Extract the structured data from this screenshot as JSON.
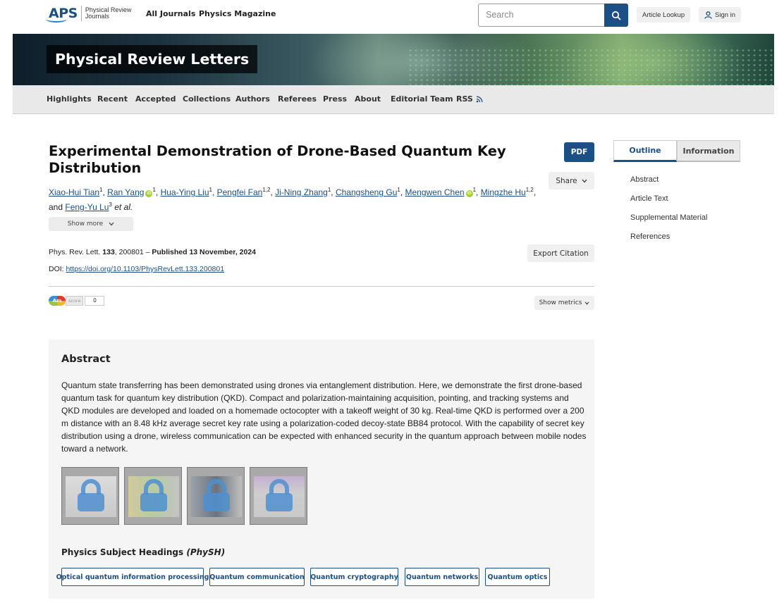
{
  "brand": {
    "logo": "APS",
    "logo_sub1": "Physical Review",
    "logo_sub2": "Journals"
  },
  "topnav": {
    "all_journals": "All Journals",
    "physics_magazine": "Physics Magazine"
  },
  "search": {
    "placeholder": "Search"
  },
  "header_actions": {
    "article_lookup": "Article Lookup",
    "sign_in": "Sign in"
  },
  "journal": {
    "title": "Physical Review Letters"
  },
  "nav": [
    "Highlights",
    "Recent",
    "Accepted",
    "Collections",
    "Authors",
    "Referees",
    "Press",
    "About",
    "Editorial Team",
    "RSS"
  ],
  "article": {
    "title": "Experimental Demonstration of Drone-Based Quantum Key Distribution",
    "pdf": "PDF",
    "share": "Share",
    "authors": [
      {
        "name": "Xiao-Hui Tian",
        "sup": "1",
        "orcid": false
      },
      {
        "name": "Ran Yang",
        "sup": "1",
        "orcid": true
      },
      {
        "name": "Hua-Ying Liu",
        "sup": "1",
        "orcid": false
      },
      {
        "name": "Pengfei Fan",
        "sup": "1,2",
        "orcid": false
      },
      {
        "name": "Ji-Ning Zhang",
        "sup": "1",
        "orcid": false
      },
      {
        "name": "Changsheng Gu",
        "sup": "1",
        "orcid": false
      },
      {
        "name": "Mengwen Chen",
        "sup": "1",
        "orcid": true
      },
      {
        "name": "Mingzhe Hu",
        "sup": "1,2",
        "orcid": false
      },
      {
        "name": "Feng-Yu Lu",
        "sup": "3",
        "orcid": false
      }
    ],
    "and_text": "and",
    "et_al": "et al.",
    "show_more": "Show more",
    "journal_abbrev": "Phys. Rev. Lett.",
    "volume": "133",
    "article_number": ", 200801 –",
    "published": "Published 13 November, 2024",
    "export_citation": "Export Citation",
    "doi_label": "DOI:",
    "doi_url": "https://doi.org/10.1103/PhysRevLett.133.200801",
    "altmetric_score_label": "score",
    "altmetric_score": "0",
    "am_badge": "Am",
    "show_metrics": "Show metrics"
  },
  "abstract": {
    "heading": "Abstract",
    "text": "Quantum state transferring has been demonstrated using drones via entanglement distribution. Here, we demonstrate the first drone-based quantum task for quantum key distribution (QKD). Compact and polarization-maintaining acquisition, pointing, and tracking systems and QKD modules are developed and loaded on a homemade octocopter with a takeoff weight of 30 kg. Real-time QKD is performed over a 200 m distance with an 8.48 kHz average secret key rate using a polarization-coded decoy-state BB84 protocol. With the capability of secret key distribution using a drone, wireless communication can be expected with enhanced security in the quantum approach between mobile nodes toward a network.",
    "physh_heading": "Physics Subject Headings",
    "physh_abbrev": "(PhySH)",
    "tags": [
      "Optical quantum information processing",
      "Quantum communication",
      "Quantum cryptography",
      "Quantum networks",
      "Quantum optics"
    ]
  },
  "sidebar": {
    "tabs": [
      "Outline",
      "Information"
    ],
    "outline": [
      "Abstract",
      "Article Text",
      "Supplemental Material",
      "References"
    ]
  },
  "colors": {
    "brand_blue": "#1b4f86",
    "orcid_green": "#a6ce39"
  }
}
